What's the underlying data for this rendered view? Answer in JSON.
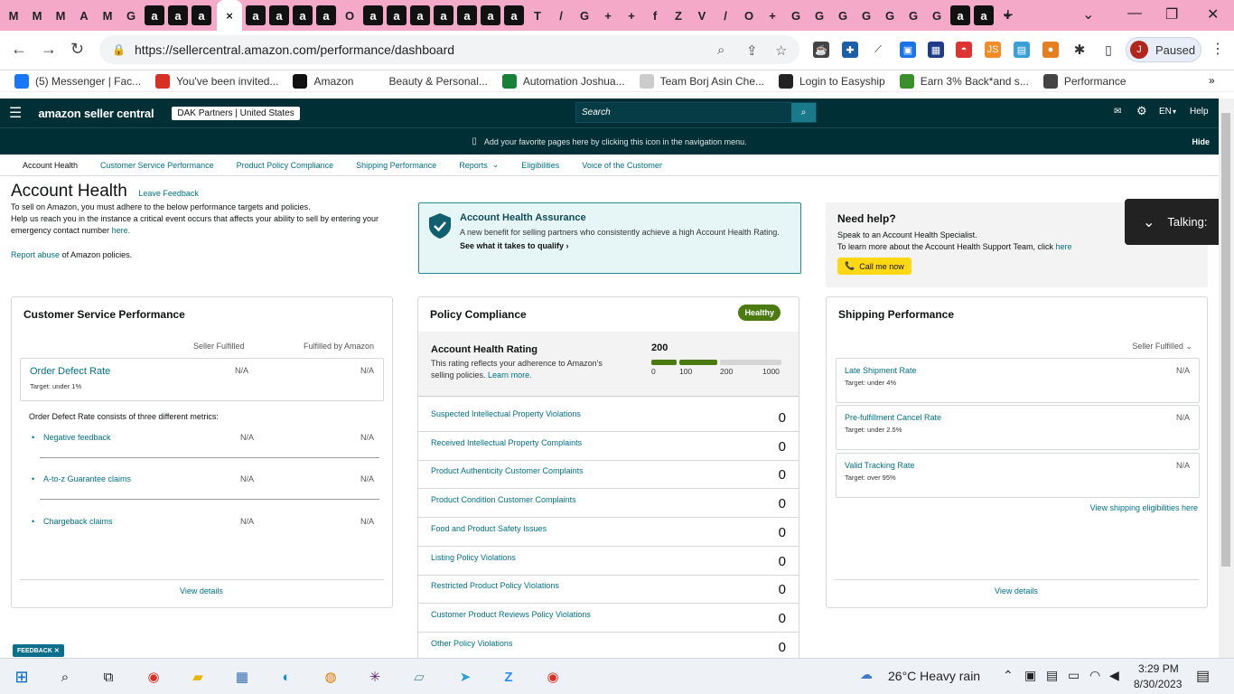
{
  "browser": {
    "url": "https://sellercentral.amazon.com/performance/dashboard",
    "profile_status": "Paused",
    "profile_initial": "J",
    "tabs": [
      "M",
      "M",
      "M",
      "A",
      "M",
      "G",
      "a",
      "a",
      "a",
      "×",
      "a",
      "a",
      "a",
      "a",
      "O",
      "a",
      "a",
      "a",
      "a",
      "a",
      "a",
      "a",
      "T",
      "/",
      "G",
      "+",
      "+",
      "f",
      "Z",
      "V",
      "/",
      "O",
      "+",
      "G",
      "G",
      "G",
      "G",
      "G",
      "G",
      "G",
      "a",
      "a",
      "+"
    ],
    "bookmarks": [
      {
        "label": "(5) Messenger | Fac...",
        "icon": "facebook-icon",
        "color": "#1877f2"
      },
      {
        "label": "You've been invited...",
        "icon": "gmail-icon",
        "color": "#d93025"
      },
      {
        "label": "Amazon",
        "icon": "amazon-icon",
        "color": "#111111"
      },
      {
        "label": "Beauty & Personal...",
        "icon": "amazon-icon",
        "color": "#ffffff"
      },
      {
        "label": "Automation Joshua...",
        "icon": "sheets-icon",
        "color": "#188038"
      },
      {
        "label": "Team Borj Asin Che...",
        "icon": "team-icon",
        "color": "#cccccc"
      },
      {
        "label": "Login to Easyship",
        "icon": "easyship-icon",
        "color": "#222222"
      },
      {
        "label": "Earn 3% Back*and s...",
        "icon": "cashback-icon",
        "color": "#3a8f2a"
      },
      {
        "label": "Performance",
        "icon": "globe-icon",
        "color": "#444444"
      }
    ]
  },
  "seller_central": {
    "logo": "amazon seller central",
    "account": "DAK Partners | United States",
    "search_placeholder": "Search",
    "language": "EN",
    "help": "Help",
    "favorites_hint": "Add your favorite pages here by clicking this icon in the navigation menu.",
    "hide": "Hide",
    "tabs": [
      "Account Health",
      "Customer Service Performance",
      "Product Policy Compliance",
      "Shipping Performance",
      "Reports",
      "Eligibilities",
      "Voice of the Customer"
    ]
  },
  "account_health": {
    "title": "Account Health",
    "leave_feedback": "Leave Feedback",
    "intro_1": "To sell on Amazon, you must adhere to the below performance targets and policies.",
    "intro_2": "Help us reach you in the instance a critical event occurs that affects your ability to sell by entering your emergency contact number",
    "intro_link": "here.",
    "report_abuse": "Report abuse",
    "report_abuse_suffix": "of Amazon policies."
  },
  "assurance": {
    "title": "Account Health Assurance",
    "body": "A new benefit for selling partners who consistently achieve a high Account Health Rating.",
    "cta": "See what it takes to qualify"
  },
  "need_help": {
    "title": "Need help?",
    "line1": "Speak to an Account Health Specialist.",
    "line2": "To learn more about the Account Health Support Team, click",
    "line2_link": "here",
    "button": "Call me now"
  },
  "talking": "Talking:",
  "customer_service": {
    "title": "Customer Service Performance",
    "col_seller": "Seller Fulfilled",
    "col_fba": "Fulfilled by Amazon",
    "odr_label": "Order Defect Rate",
    "odr_target": "Target: under 1%",
    "odr_seller": "N/A",
    "odr_fba": "N/A",
    "consists": "Order Defect Rate consists of three different metrics:",
    "metrics": [
      {
        "name": "Negative feedback",
        "seller": "N/A",
        "fba": "N/A"
      },
      {
        "name": "A-to-z Guarantee claims",
        "seller": "N/A",
        "fba": "N/A"
      },
      {
        "name": "Chargeback claims",
        "seller": "N/A",
        "fba": "N/A"
      }
    ],
    "view_details": "View details"
  },
  "policy_compliance": {
    "title": "Policy Compliance",
    "badge": "Healthy",
    "rating_title": "Account Health Rating",
    "rating_desc": "This rating reflects your adherence to Amazon's selling policies.",
    "rating_link": "Learn more.",
    "rating_value": "200",
    "scale_ticks": [
      "0",
      "100",
      "200",
      "1000"
    ],
    "rows": [
      {
        "label": "Suspected Intellectual Property Violations",
        "value": "0"
      },
      {
        "label": "Received Intellectual Property Complaints",
        "value": "0"
      },
      {
        "label": "Product Authenticity Customer Complaints",
        "value": "0"
      },
      {
        "label": "Product Condition Customer Complaints",
        "value": "0"
      },
      {
        "label": "Food and Product Safety Issues",
        "value": "0"
      },
      {
        "label": "Listing Policy Violations",
        "value": "0"
      },
      {
        "label": "Restricted Product Policy Violations",
        "value": "0"
      },
      {
        "label": "Customer Product Reviews Policy Violations",
        "value": "0"
      },
      {
        "label": "Other Policy Violations",
        "value": "0"
      }
    ]
  },
  "shipping": {
    "title": "Shipping Performance",
    "selector": "Seller Fulfilled",
    "metrics": [
      {
        "name": "Late Shipment Rate",
        "target": "Target: under 4%",
        "value": "N/A"
      },
      {
        "name": "Pre-fulfillment Cancel Rate",
        "target": "Target: under 2.5%",
        "value": "N/A"
      },
      {
        "name": "Valid Tracking Rate",
        "target": "Target: over 95%",
        "value": "N/A"
      }
    ],
    "eligibilities_link": "View shipping eligibilities here",
    "view_details": "View details"
  },
  "feedback": "FEEDBACK",
  "taskbar": {
    "weather": "26°C  Heavy rain",
    "time": "3:29 PM",
    "date": "8/30/2023"
  }
}
